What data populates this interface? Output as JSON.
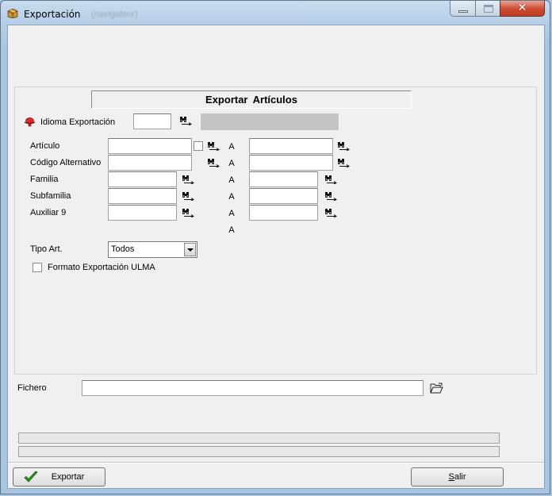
{
  "window": {
    "title": "Exportación",
    "ghost_title": "(navigateur)",
    "close_glyph": "✕"
  },
  "header": {
    "title": "Exportar  Artículos"
  },
  "idioma": {
    "label": "Idioma Exportación",
    "value": "",
    "description": ""
  },
  "range_separator": "A",
  "rows": [
    {
      "label": "Artículo",
      "from": "",
      "to": ""
    },
    {
      "label": "Código Alternativo",
      "from": "",
      "to": ""
    },
    {
      "label": "Familia",
      "from": "",
      "to": ""
    },
    {
      "label": "Subfamilia",
      "from": "",
      "to": ""
    },
    {
      "label": "Auxiliar 9",
      "from": "",
      "to": ""
    }
  ],
  "tipo_art": {
    "label": "Tipo Art.",
    "selected": "Todos"
  },
  "formato_ulma": {
    "label": "Formato Exportación ULMA",
    "checked": false
  },
  "fichero": {
    "label": "Fichero",
    "value": ""
  },
  "progress": [
    0,
    0
  ],
  "buttons": {
    "exportar": "Exportar",
    "salir_prefix": "",
    "salir_u": "S",
    "salir_rest": "alir"
  },
  "icons": {
    "app": "package-icon",
    "required": "red-hat-icon",
    "lookup": "binoculars-arrow-icon",
    "folder": "open-folder-icon",
    "ok": "green-check-icon"
  }
}
